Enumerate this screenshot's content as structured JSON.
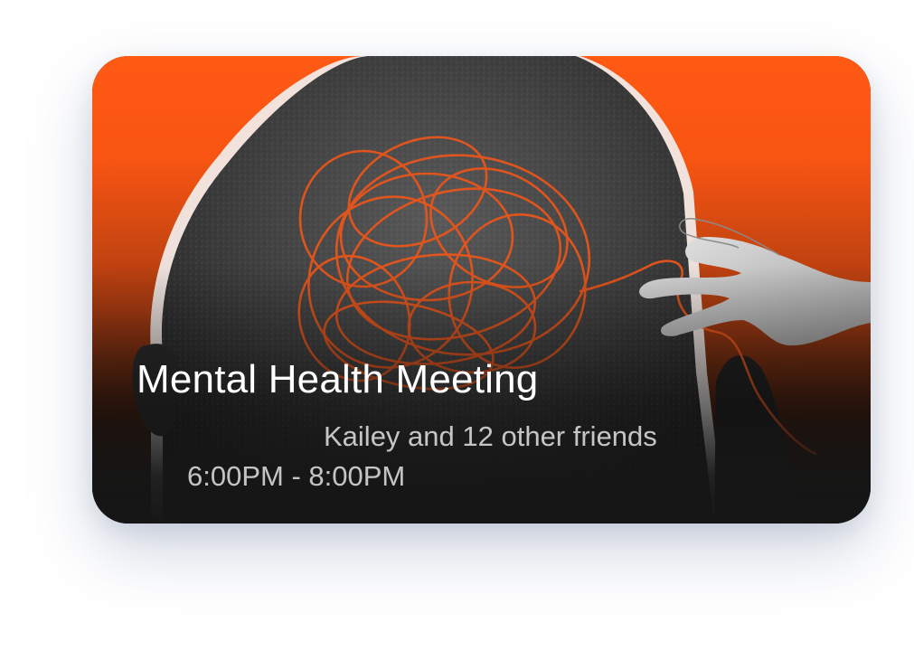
{
  "event_card": {
    "title": "Mental Health Meeting",
    "attendees": "Kailey and 12 other friends",
    "time": "6:00PM - 8:00PM",
    "image_icon": "tangled-thoughts-head-illustration",
    "colors": {
      "accent_orange": "#ff5a14",
      "thread_orange": "#e8561c",
      "card_dark": "#161616"
    }
  }
}
